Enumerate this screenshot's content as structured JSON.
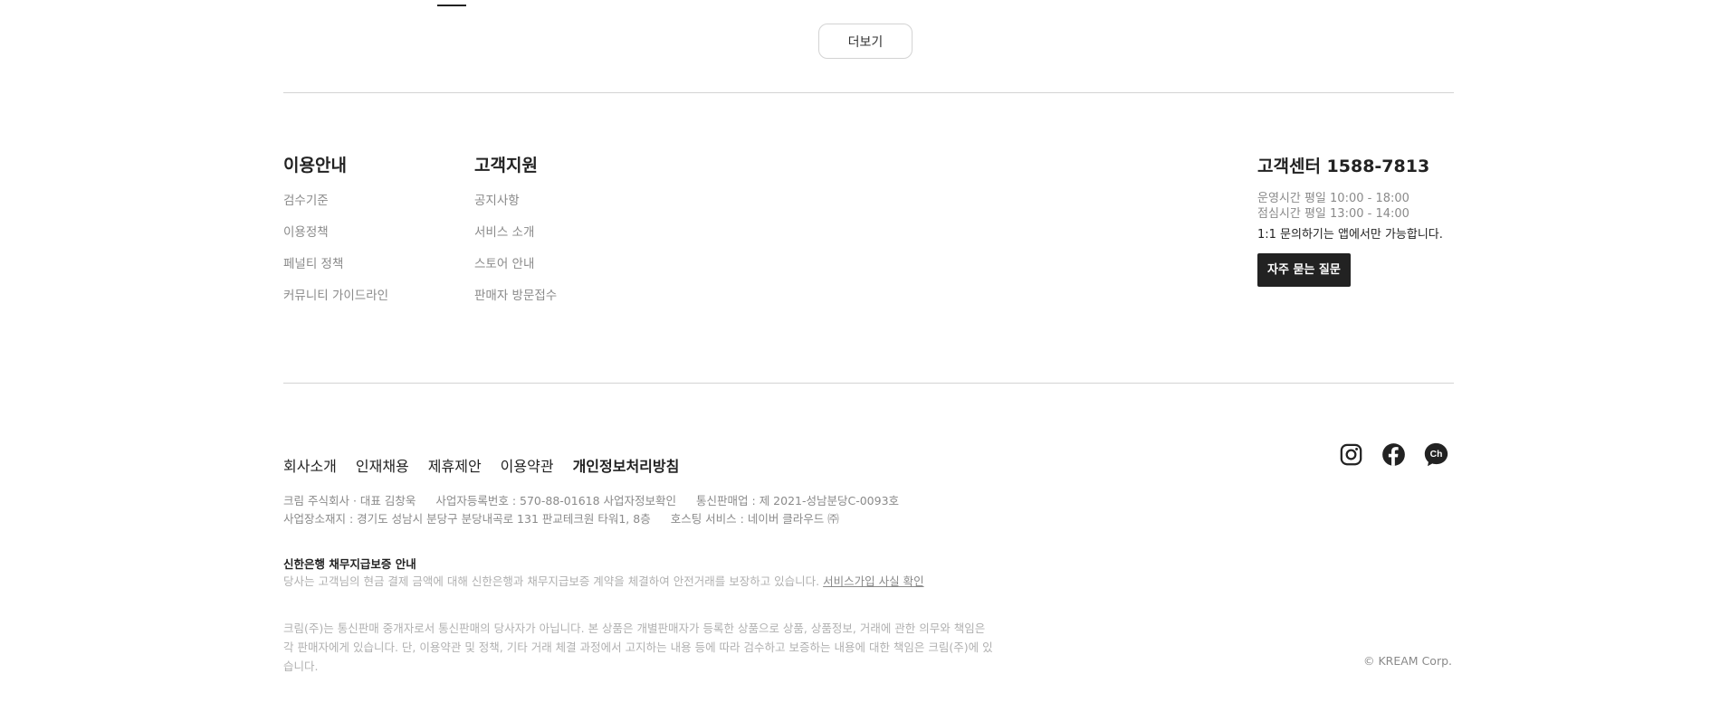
{
  "more": {
    "label": "더보기"
  },
  "footer": {
    "columns": [
      {
        "title": "이용안내",
        "items": [
          "검수기준",
          "이용정책",
          "페널티 정책",
          "커뮤니티 가이드라인"
        ]
      },
      {
        "title": "고객지원",
        "items": [
          "공지사항",
          "서비스 소개",
          "스토어 안내",
          "판매자 방문접수"
        ]
      }
    ],
    "cs": {
      "title": "고객센터 1588-7813",
      "hours1": "운영시간 평일 10:00 - 18:00",
      "hours2": "점심시간 평일 13:00 - 14:00",
      "note": "1:1 문의하기는 앱에서만 가능합니다.",
      "faq": "자주 묻는 질문"
    },
    "links": [
      "회사소개",
      "인재채용",
      "제휴제안",
      "이용약관",
      "개인정보처리방침"
    ],
    "social": [
      "instagram-icon",
      "facebook-icon",
      "channel-talk-icon"
    ],
    "biz": {
      "line1a": "크림 주식회사 · 대표 김창욱",
      "line1b": "사업자등록번호 : 570-88-01618 사업자정보확인",
      "line1c": "통신판매업 : 제 2021-성남분당C-0093호",
      "line2a": "사업장소재지 : 경기도 성남시 분당구 분당내곡로 131 판교테크원 타워1, 8층",
      "line2b": "호스팅 서비스 : 네이버 클라우드 ㈜"
    },
    "guarantee": {
      "title": "신한은행 채무지급보증 안내",
      "text": "당사는 고객님의 현금 결제 금액에 대해 신한은행과 채무지급보증 계약을 체결하여 안전거래를 보장하고 있습니다.",
      "link": "서비스가입 사실 확인"
    },
    "disclaimer": "크림(주)는 통신판매 중개자로서 통신판매의 당사자가 아닙니다. 본 상품은 개별판매자가 등록한 상품으로 상품, 상품정보, 거래에 관한 의무와 책임은 각 판매자에게 있습니다. 단, 이용약관 및 정책, 기타 거래 체결 과정에서 고지하는 내용 등에 따라 검수하고 보증하는 내용에 대한 책임은 크림(주)에 있습니다.",
    "copyright": "© KREAM Corp."
  }
}
